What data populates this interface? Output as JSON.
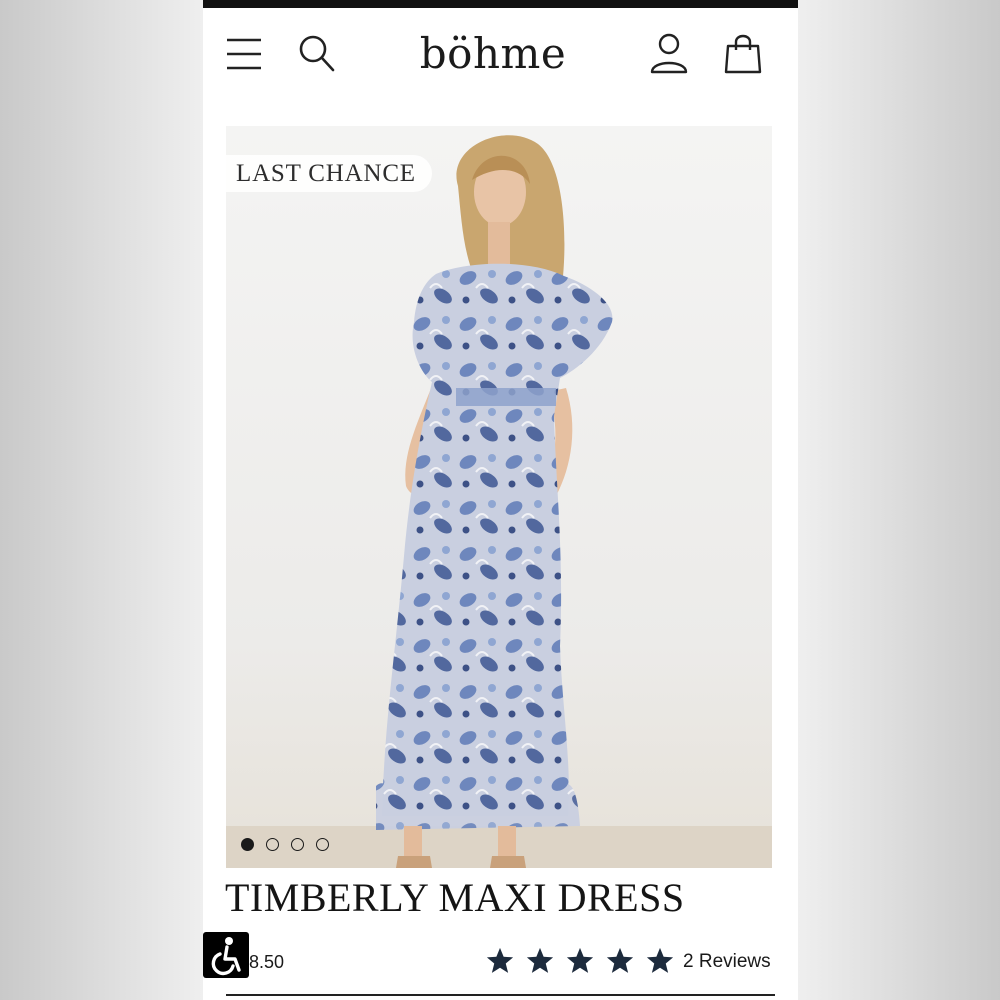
{
  "header": {
    "logo": "böhme",
    "icons": [
      "menu-icon",
      "search-icon",
      "account-icon",
      "shopping-bag-icon"
    ]
  },
  "product": {
    "badge": "LAST CHANCE",
    "title": "TIMBERLY MAXI DRESS",
    "price_partial": "8.50",
    "rating": 5,
    "rating_max": 5,
    "reviews_label": "2 Reviews",
    "image_count": 4,
    "active_image": 1
  },
  "colors": {
    "text": "#1a1a1a",
    "dress_blue": "#7d93bf",
    "background": "#ffffff"
  }
}
